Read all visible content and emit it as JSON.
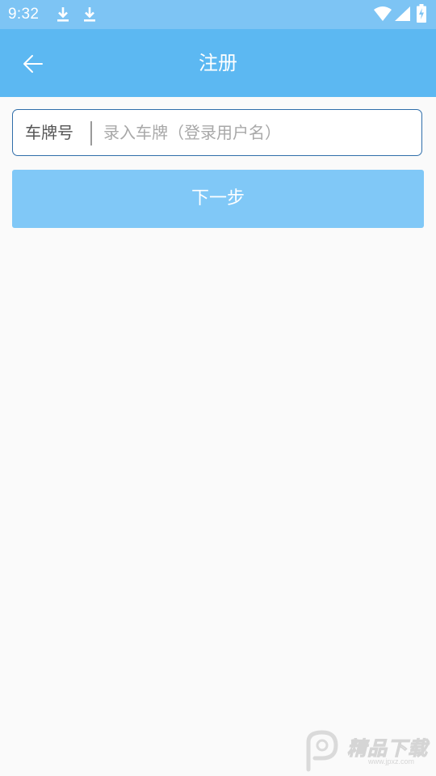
{
  "status_bar": {
    "time": "9:32",
    "icons": [
      "download-icon",
      "download-icon",
      "wifi-icon",
      "signal-icon",
      "battery-charging-icon"
    ]
  },
  "app_bar": {
    "title": "注册",
    "back_icon": "arrow-left-icon"
  },
  "form": {
    "plate_label": "车牌号",
    "plate_placeholder": "录入车牌（登录用户名）",
    "plate_value": "",
    "next_label": "下一步"
  },
  "watermark": {
    "text": "精品下载",
    "url": "www.jpxz.com"
  },
  "colors": {
    "status_bar": "#7dc4f4",
    "app_bar": "#5cb8f2",
    "button": "#80c8f7",
    "field_border": "#2f6eaa",
    "background": "#fafafa"
  }
}
